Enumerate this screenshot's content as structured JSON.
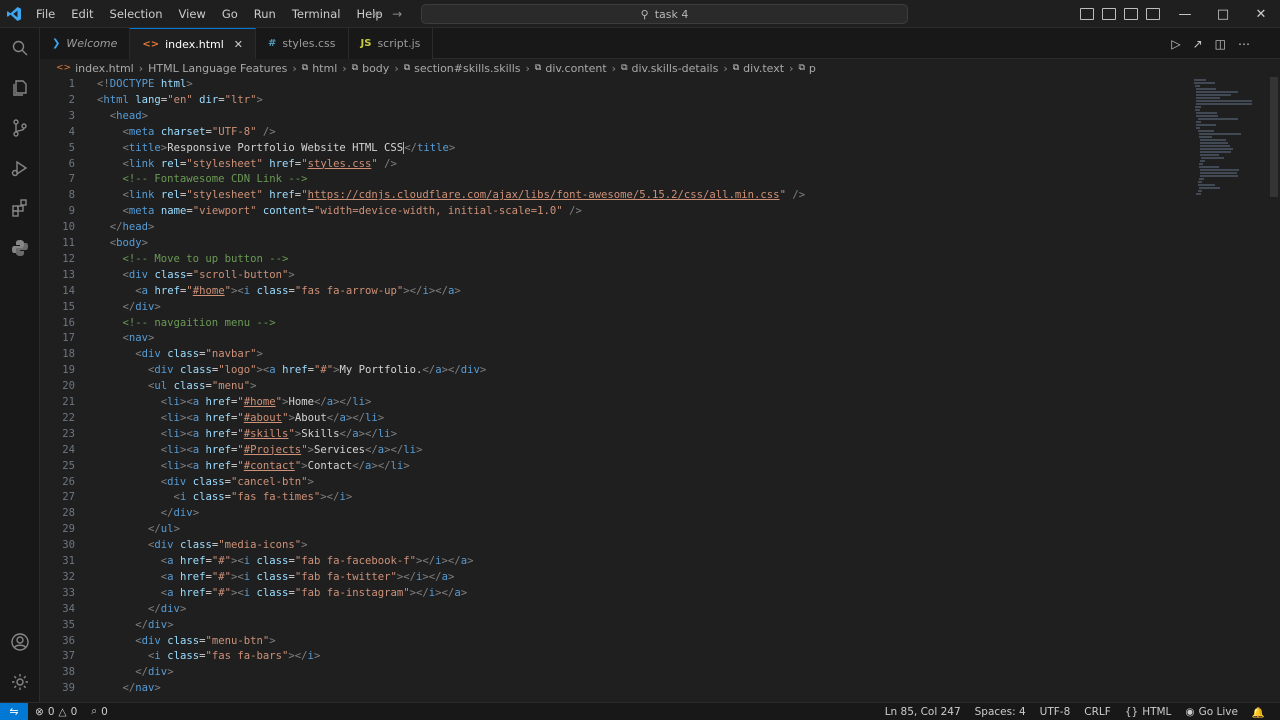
{
  "titlebar": {
    "menu": [
      "File",
      "Edit",
      "Selection",
      "View",
      "Go",
      "Run",
      "Terminal",
      "Help"
    ],
    "search_text": "task 4"
  },
  "tabs": [
    {
      "label": "Welcome",
      "icon": "vscode-icon",
      "active": false
    },
    {
      "label": "index.html",
      "icon": "html-icon",
      "active": true
    },
    {
      "label": "styles.css",
      "icon": "css-icon",
      "active": false
    },
    {
      "label": "script.js",
      "icon": "js-icon",
      "active": false
    }
  ],
  "breadcrumb": [
    "index.html",
    "HTML Language Features",
    "html",
    "body",
    "section#skills.skills",
    "div.content",
    "div.skills-details",
    "div.text",
    "p"
  ],
  "editor": {
    "lines": [
      {
        "n": "1",
        "html": "<span class='t-punc'>&lt;!</span><span class='t-dt'>DOCTYPE</span> <span class='t-attr'>html</span><span class='t-punc'>&gt;</span>"
      },
      {
        "n": "2",
        "html": "<span class='t-punc'>&lt;</span><span class='t-tag'>html</span> <span class='t-attr'>lang</span><span class='t-txt'>=</span><span class='t-str'>\"en\"</span> <span class='t-attr'>dir</span><span class='t-txt'>=</span><span class='t-str'>\"ltr\"</span><span class='t-punc'>&gt;</span>"
      },
      {
        "n": "3",
        "html": "  <span class='t-punc'>&lt;</span><span class='t-tag'>head</span><span class='t-punc'>&gt;</span>"
      },
      {
        "n": "4",
        "html": "    <span class='t-punc'>&lt;</span><span class='t-tag'>meta</span> <span class='t-attr'>charset</span><span class='t-txt'>=</span><span class='t-str'>\"UTF-8\"</span> <span class='t-punc'>/&gt;</span>"
      },
      {
        "n": "5",
        "html": "    <span class='t-punc'>&lt;</span><span class='t-tag'>title</span><span class='t-punc'>&gt;</span><span class='t-txt'>Responsive Portfolio Website HTML CSS</span><span class='caret'></span><span class='t-punc'>&lt;/</span><span class='t-tag'>title</span><span class='t-punc'>&gt;</span>"
      },
      {
        "n": "6",
        "html": "    <span class='t-punc'>&lt;</span><span class='t-tag'>link</span> <span class='t-attr'>rel</span><span class='t-txt'>=</span><span class='t-str'>\"stylesheet\"</span> <span class='t-attr'>href</span><span class='t-txt'>=</span><span class='t-str'>\"<u>styles.css</u>\"</span> <span class='t-punc'>/&gt;</span>"
      },
      {
        "n": "7",
        "html": "    <span class='t-com'>&lt;!-- Fontawesome CDN Link --&gt;</span>"
      },
      {
        "n": "8",
        "html": "    <span class='t-punc'>&lt;</span><span class='t-tag'>link</span> <span class='t-attr'>rel</span><span class='t-txt'>=</span><span class='t-str'>\"stylesheet\"</span> <span class='t-attr'>href</span><span class='t-txt'>=</span><span class='t-str'>\"<u>https://cdnjs.cloudflare.com/ajax/libs/font-awesome/5.15.2/css/all.min.css</u>\"</span> <span class='t-punc'>/&gt;</span>"
      },
      {
        "n": "9",
        "html": "    <span class='t-punc'>&lt;</span><span class='t-tag'>meta</span> <span class='t-attr'>name</span><span class='t-txt'>=</span><span class='t-str'>\"viewport\"</span> <span class='t-attr'>content</span><span class='t-txt'>=</span><span class='t-str'>\"width=device-width, initial-scale=1.0\"</span> <span class='t-punc'>/&gt;</span>"
      },
      {
        "n": "10",
        "html": "  <span class='t-punc'>&lt;/</span><span class='t-tag'>head</span><span class='t-punc'>&gt;</span>"
      },
      {
        "n": "11",
        "html": "  <span class='t-punc'>&lt;</span><span class='t-tag'>body</span><span class='t-punc'>&gt;</span>"
      },
      {
        "n": "12",
        "html": "    <span class='t-com'>&lt;!-- Move to up button --&gt;</span>"
      },
      {
        "n": "13",
        "html": "    <span class='t-punc'>&lt;</span><span class='t-tag'>div</span> <span class='t-attr'>class</span><span class='t-txt'>=</span><span class='t-str'>\"scroll-button\"</span><span class='t-punc'>&gt;</span>"
      },
      {
        "n": "14",
        "html": "      <span class='t-punc'>&lt;</span><span class='t-tag'>a</span> <span class='t-attr'>href</span><span class='t-txt'>=</span><span class='t-str'>\"<u>#home</u>\"</span><span class='t-punc'>&gt;&lt;</span><span class='t-tag'>i</span> <span class='t-attr'>class</span><span class='t-txt'>=</span><span class='t-str'>\"fas fa-arrow-up\"</span><span class='t-punc'>&gt;&lt;/</span><span class='t-tag'>i</span><span class='t-punc'>&gt;&lt;/</span><span class='t-tag'>a</span><span class='t-punc'>&gt;</span>"
      },
      {
        "n": "15",
        "html": "    <span class='t-punc'>&lt;/</span><span class='t-tag'>div</span><span class='t-punc'>&gt;</span>"
      },
      {
        "n": "16",
        "html": "    <span class='t-com'>&lt;!-- navgaition menu --&gt;</span>"
      },
      {
        "n": "17",
        "html": "    <span class='t-punc'>&lt;</span><span class='t-tag'>nav</span><span class='t-punc'>&gt;</span>"
      },
      {
        "n": "18",
        "html": "      <span class='t-punc'>&lt;</span><span class='t-tag'>div</span> <span class='t-attr'>class</span><span class='t-txt'>=</span><span class='t-str'>\"navbar\"</span><span class='t-punc'>&gt;</span>"
      },
      {
        "n": "19",
        "html": "        <span class='t-punc'>&lt;</span><span class='t-tag'>div</span> <span class='t-attr'>class</span><span class='t-txt'>=</span><span class='t-str'>\"logo\"</span><span class='t-punc'>&gt;&lt;</span><span class='t-tag'>a</span> <span class='t-attr'>href</span><span class='t-txt'>=</span><span class='t-str'>\"#\"</span><span class='t-punc'>&gt;</span><span class='t-txt'>My Portfolio.</span><span class='t-punc'>&lt;/</span><span class='t-tag'>a</span><span class='t-punc'>&gt;&lt;/</span><span class='t-tag'>div</span><span class='t-punc'>&gt;</span>"
      },
      {
        "n": "20",
        "html": "        <span class='t-punc'>&lt;</span><span class='t-tag'>ul</span> <span class='t-attr'>class</span><span class='t-txt'>=</span><span class='t-str'>\"menu\"</span><span class='t-punc'>&gt;</span>"
      },
      {
        "n": "21",
        "html": "          <span class='t-punc'>&lt;</span><span class='t-tag'>li</span><span class='t-punc'>&gt;&lt;</span><span class='t-tag'>a</span> <span class='t-attr'>href</span><span class='t-txt'>=</span><span class='t-str'>\"<u>#home</u>\"</span><span class='t-punc'>&gt;</span><span class='t-txt'>Home</span><span class='t-punc'>&lt;/</span><span class='t-tag'>a</span><span class='t-punc'>&gt;&lt;/</span><span class='t-tag'>li</span><span class='t-punc'>&gt;</span>"
      },
      {
        "n": "22",
        "html": "          <span class='t-punc'>&lt;</span><span class='t-tag'>li</span><span class='t-punc'>&gt;&lt;</span><span class='t-tag'>a</span> <span class='t-attr'>href</span><span class='t-txt'>=</span><span class='t-str'>\"<u>#about</u>\"</span><span class='t-punc'>&gt;</span><span class='t-txt'>About</span><span class='t-punc'>&lt;/</span><span class='t-tag'>a</span><span class='t-punc'>&gt;&lt;/</span><span class='t-tag'>li</span><span class='t-punc'>&gt;</span>"
      },
      {
        "n": "23",
        "html": "          <span class='t-punc'>&lt;</span><span class='t-tag'>li</span><span class='t-punc'>&gt;&lt;</span><span class='t-tag'>a</span> <span class='t-attr'>href</span><span class='t-txt'>=</span><span class='t-str'>\"<u>#skills</u>\"</span><span class='t-punc'>&gt;</span><span class='t-txt'>Skills</span><span class='t-punc'>&lt;/</span><span class='t-tag'>a</span><span class='t-punc'>&gt;&lt;/</span><span class='t-tag'>li</span><span class='t-punc'>&gt;</span>"
      },
      {
        "n": "24",
        "html": "          <span class='t-punc'>&lt;</span><span class='t-tag'>li</span><span class='t-punc'>&gt;&lt;</span><span class='t-tag'>a</span> <span class='t-attr'>href</span><span class='t-txt'>=</span><span class='t-str'>\"<u>#Projects</u>\"</span><span class='t-punc'>&gt;</span><span class='t-txt'>Services</span><span class='t-punc'>&lt;/</span><span class='t-tag'>a</span><span class='t-punc'>&gt;&lt;/</span><span class='t-tag'>li</span><span class='t-punc'>&gt;</span>"
      },
      {
        "n": "25",
        "html": "          <span class='t-punc'>&lt;</span><span class='t-tag'>li</span><span class='t-punc'>&gt;&lt;</span><span class='t-tag'>a</span> <span class='t-attr'>href</span><span class='t-txt'>=</span><span class='t-str'>\"<u>#contact</u>\"</span><span class='t-punc'>&gt;</span><span class='t-txt'>Contact</span><span class='t-punc'>&lt;/</span><span class='t-tag'>a</span><span class='t-punc'>&gt;&lt;/</span><span class='t-tag'>li</span><span class='t-punc'>&gt;</span>"
      },
      {
        "n": "26",
        "html": "          <span class='t-punc'>&lt;</span><span class='t-tag'>div</span> <span class='t-attr'>class</span><span class='t-txt'>=</span><span class='t-str'>\"cancel-btn\"</span><span class='t-punc'>&gt;</span>"
      },
      {
        "n": "27",
        "html": "            <span class='t-punc'>&lt;</span><span class='t-tag'>i</span> <span class='t-attr'>class</span><span class='t-txt'>=</span><span class='t-str'>\"fas fa-times\"</span><span class='t-punc'>&gt;&lt;/</span><span class='t-tag'>i</span><span class='t-punc'>&gt;</span>"
      },
      {
        "n": "28",
        "html": "          <span class='t-punc'>&lt;/</span><span class='t-tag'>div</span><span class='t-punc'>&gt;</span>"
      },
      {
        "n": "29",
        "html": "        <span class='t-punc'>&lt;/</span><span class='t-tag'>ul</span><span class='t-punc'>&gt;</span>"
      },
      {
        "n": "30",
        "html": "        <span class='t-punc'>&lt;</span><span class='t-tag'>div</span> <span class='t-attr'>class</span><span class='t-txt'>=</span><span class='t-str'>\"media-icons\"</span><span class='t-punc'>&gt;</span>"
      },
      {
        "n": "31",
        "html": "          <span class='t-punc'>&lt;</span><span class='t-tag'>a</span> <span class='t-attr'>href</span><span class='t-txt'>=</span><span class='t-str'>\"#\"</span><span class='t-punc'>&gt;&lt;</span><span class='t-tag'>i</span> <span class='t-attr'>class</span><span class='t-txt'>=</span><span class='t-str'>\"fab fa-facebook-f\"</span><span class='t-punc'>&gt;&lt;/</span><span class='t-tag'>i</span><span class='t-punc'>&gt;&lt;/</span><span class='t-tag'>a</span><span class='t-punc'>&gt;</span>"
      },
      {
        "n": "32",
        "html": "          <span class='t-punc'>&lt;</span><span class='t-tag'>a</span> <span class='t-attr'>href</span><span class='t-txt'>=</span><span class='t-str'>\"#\"</span><span class='t-punc'>&gt;&lt;</span><span class='t-tag'>i</span> <span class='t-attr'>class</span><span class='t-txt'>=</span><span class='t-str'>\"fab fa-twitter\"</span><span class='t-punc'>&gt;&lt;/</span><span class='t-tag'>i</span><span class='t-punc'>&gt;&lt;/</span><span class='t-tag'>a</span><span class='t-punc'>&gt;</span>"
      },
      {
        "n": "33",
        "html": "          <span class='t-punc'>&lt;</span><span class='t-tag'>a</span> <span class='t-attr'>href</span><span class='t-txt'>=</span><span class='t-str'>\"#\"</span><span class='t-punc'>&gt;&lt;</span><span class='t-tag'>i</span> <span class='t-attr'>class</span><span class='t-txt'>=</span><span class='t-str'>\"fab fa-instagram\"</span><span class='t-punc'>&gt;&lt;/</span><span class='t-tag'>i</span><span class='t-punc'>&gt;&lt;/</span><span class='t-tag'>a</span><span class='t-punc'>&gt;</span>"
      },
      {
        "n": "34",
        "html": "        <span class='t-punc'>&lt;/</span><span class='t-tag'>div</span><span class='t-punc'>&gt;</span>"
      },
      {
        "n": "35",
        "html": "      <span class='t-punc'>&lt;/</span><span class='t-tag'>div</span><span class='t-punc'>&gt;</span>"
      },
      {
        "n": "36",
        "html": "      <span class='t-punc'>&lt;</span><span class='t-tag'>div</span> <span class='t-attr'>class</span><span class='t-txt'>=</span><span class='t-str'>\"menu-btn\"</span><span class='t-punc'>&gt;</span>"
      },
      {
        "n": "37",
        "html": "        <span class='t-punc'>&lt;</span><span class='t-tag'>i</span> <span class='t-attr'>class</span><span class='t-txt'>=</span><span class='t-str'>\"fas fa-bars\"</span><span class='t-punc'>&gt;&lt;/</span><span class='t-tag'>i</span><span class='t-punc'>&gt;</span>"
      },
      {
        "n": "38",
        "html": "      <span class='t-punc'>&lt;/</span><span class='t-tag'>div</span><span class='t-punc'>&gt;</span>"
      },
      {
        "n": "39",
        "html": "    <span class='t-punc'>&lt;/</span><span class='t-tag'>nav</span><span class='t-punc'>&gt;</span>"
      }
    ]
  },
  "statusbar": {
    "errors": "0",
    "warnings": "0",
    "ports": "0",
    "position": "Ln 85, Col 247",
    "spaces": "Spaces: 4",
    "encoding": "UTF-8",
    "eol": "CRLF",
    "language": "HTML",
    "golive": "Go Live"
  },
  "colors": {
    "accent": "#0078d4",
    "tag": "#569cd6",
    "attribute": "#9cdcfe",
    "string": "#ce9178",
    "comment": "#6a9955"
  }
}
